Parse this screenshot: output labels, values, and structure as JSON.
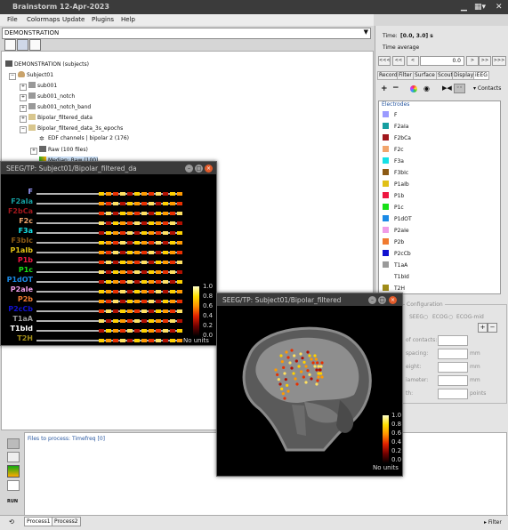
{
  "app": {
    "title": "Brainstorm 12-Apr-2023"
  },
  "menu": {
    "items": [
      "File",
      "Colormaps",
      "Update",
      "Plugins",
      "Help"
    ]
  },
  "protocol": {
    "selected": "DEMONSTRATION"
  },
  "tree": {
    "root": "DEMONSTRATION (subjects)",
    "nodes": [
      {
        "label": "Subject01"
      },
      {
        "label": "sub001"
      },
      {
        "label": "sub001_notch"
      },
      {
        "label": "sub001_notch_band"
      },
      {
        "label": "Bipolar_filtered_data"
      },
      {
        "label": "Bipolar_filtered_data_3s_epochs"
      },
      {
        "label": "EDF channels | bipolar 2 (176)"
      },
      {
        "label": "Raw (100 files)"
      },
      {
        "label": "Median: Raw (100)"
      }
    ]
  },
  "time_panel": {
    "time_label": "Time:",
    "time_value": "[0.0, 3.0] s",
    "average_label": "Time average",
    "nav_buttons": [
      "<<<",
      "<<",
      "<",
      ">",
      ">>",
      ">>>"
    ],
    "value": "0.0"
  },
  "right_tabs": [
    "Record",
    "Filter",
    "Surface",
    "Scout",
    "Display",
    "iEEG"
  ],
  "ieeg": {
    "contacts_label": "Contacts",
    "electrodes_header": "Electrodes",
    "electrodes": [
      {
        "name": "F",
        "color": "#9a9aff"
      },
      {
        "name": "F2aIa",
        "color": "#159ea0"
      },
      {
        "name": "F2bCa",
        "color": "#a0171c"
      },
      {
        "name": "F2c",
        "color": "#f2a56c"
      },
      {
        "name": "F3a",
        "color": "#15e0e6"
      },
      {
        "name": "F3bIc",
        "color": "#8c5a14"
      },
      {
        "name": "P1aIb",
        "color": "#e0c015"
      },
      {
        "name": "P1b",
        "color": "#ee1640"
      },
      {
        "name": "P1c",
        "color": "#18e018"
      },
      {
        "name": "P1dOT",
        "color": "#1a8ae6"
      },
      {
        "name": "P2aIe",
        "color": "#f09ce8"
      },
      {
        "name": "P2b",
        "color": "#f07a30"
      },
      {
        "name": "P2cCb",
        "color": "#1010d0"
      },
      {
        "name": "T1aA",
        "color": "#9a9a9a"
      },
      {
        "name": "T1bId",
        "color": "#ffffff"
      },
      {
        "name": "T2H",
        "color": "#a08c18"
      }
    ],
    "config_label": "Configuration",
    "modality_options": [
      "SEEG",
      "ECOG",
      "ECOG-mid"
    ],
    "fields": [
      "of contacts:",
      "spacing:",
      "eight:",
      "iameter:",
      "th:"
    ],
    "units": [
      "mm",
      "mm",
      "mm",
      "points"
    ]
  },
  "process": {
    "label": "Files to process: Timefreq [0]",
    "tabs": [
      "Process1",
      "Process2"
    ],
    "run_label": "RUN",
    "filter_label": "Filter"
  },
  "fig1": {
    "title": "SEEG/TP: Subject01/Bipolar_filtered_da",
    "colorbar_ticks": [
      "1.0",
      "0.8",
      "0.6",
      "0.4",
      "0.2",
      "0.0"
    ],
    "units": "No units"
  },
  "fig2": {
    "title": "SEEG/TP: Subject01/Bipolar_filtered",
    "colorbar_ticks": [
      "1.0",
      "0.8",
      "0.6",
      "0.4",
      "0.2",
      "0.0"
    ],
    "units": "No units"
  },
  "colors": {
    "titlebar": "#3b3b3b",
    "selection": "#cfe3f8"
  }
}
